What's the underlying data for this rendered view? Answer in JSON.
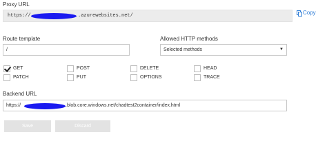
{
  "proxy": {
    "label": "Proxy URL",
    "url_prefix": "https://",
    "url_suffix": ".azurewebsites.net/",
    "copy_label": "Copy"
  },
  "route": {
    "label": "Route template",
    "value": "/"
  },
  "methods": {
    "label": "Allowed HTTP methods",
    "selected": "Selected methods",
    "items": [
      {
        "label": "GET",
        "checked": true
      },
      {
        "label": "POST",
        "checked": false
      },
      {
        "label": "DELETE",
        "checked": false
      },
      {
        "label": "HEAD",
        "checked": false
      },
      {
        "label": "PATCH",
        "checked": false
      },
      {
        "label": "PUT",
        "checked": false
      },
      {
        "label": "OPTIONS",
        "checked": false
      },
      {
        "label": "TRACE",
        "checked": false
      }
    ]
  },
  "backend": {
    "label": "Backend URL",
    "url_prefix": "https://",
    "url_suffix": ".blob.core.windows.net/chadtest2container/index.html"
  },
  "actions": {
    "save_label": "Save",
    "discard_label": "Discard"
  },
  "colors": {
    "redaction": "#1a1af0",
    "link": "#2d7cd6",
    "disabled_button": "#e3e3e3"
  }
}
